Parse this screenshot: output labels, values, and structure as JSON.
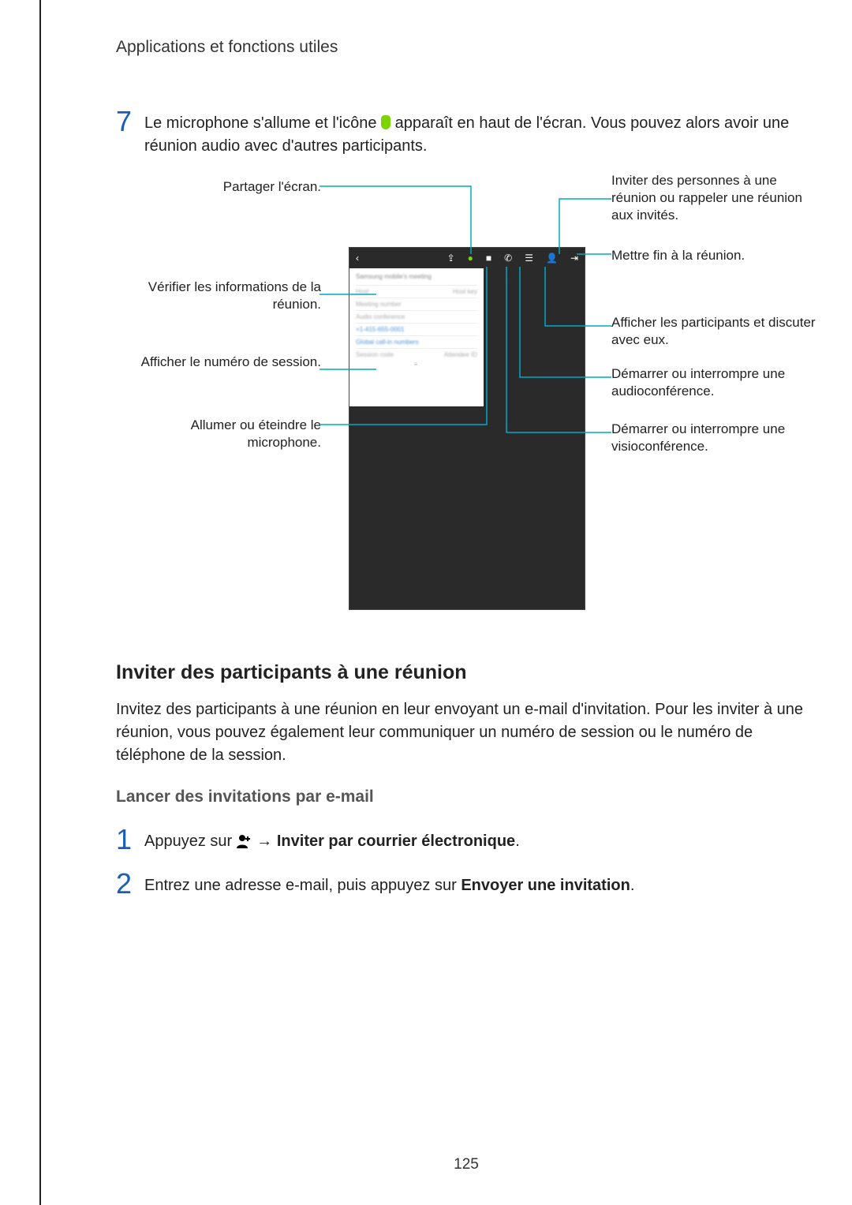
{
  "header": "Applications et fonctions utiles",
  "step7": {
    "num": "7",
    "text_before": "Le microphone s'allume et l'icône ",
    "text_after": " apparaît en haut de l'écran. Vous pouvez alors avoir une réunion audio avec d'autres participants."
  },
  "callouts": {
    "left": {
      "share": "Partager l'écran.",
      "info": "Vérifier les informations de la réunion.",
      "session": "Afficher le numéro de session.",
      "mic": "Allumer ou éteindre le microphone."
    },
    "right": {
      "invite": "Inviter des personnes à une réunion ou rappeler une réunion aux invités.",
      "end": "Mettre fin à la réunion.",
      "participants": "Afficher les participants et discuter avec eux.",
      "audio": "Démarrer ou interrompre une audioconférence.",
      "video": "Démarrer ou interrompre une visioconférence."
    }
  },
  "panel": {
    "title": "Samsung mobile's meeting",
    "row1a": "Host",
    "row1b": "Host key",
    "row2a": "Meeting number",
    "row3a": "Audio conference",
    "row4a": "Attendee ID",
    "row4b": "Session",
    "row5a": "Session code"
  },
  "section": {
    "title": "Inviter des participants à une réunion",
    "body": "Invitez des participants à une réunion en leur envoyant un e-mail d'invitation. Pour les inviter à une réunion, vous pouvez également leur communiquer un numéro de session ou le numéro de téléphone de la session.",
    "subtitle": "Lancer des invitations par e-mail"
  },
  "step1": {
    "num": "1",
    "pre": "Appuyez sur ",
    "arrow": "→",
    "bold": "Inviter par courrier électronique",
    "period": "."
  },
  "step2": {
    "num": "2",
    "pre": "Entrez une adresse e-mail, puis appuyez sur ",
    "bold": "Envoyer une invitation",
    "period": "."
  },
  "page_number": "125"
}
